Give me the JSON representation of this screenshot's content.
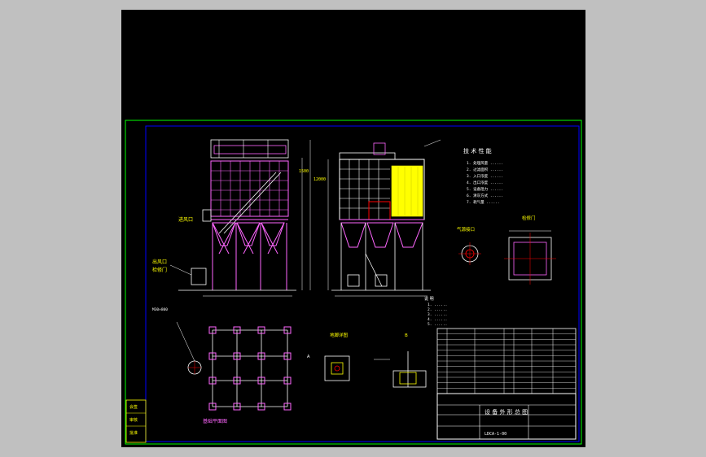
{
  "colors": {
    "background": "#c0c0c0",
    "canvas": "#000000",
    "border": "#00ff00",
    "structure": "#ff66ff",
    "line": "#ffffff",
    "dimension": "#ffff00",
    "accent": "#ff0000",
    "cyan": "#00ffff"
  },
  "drawing": {
    "tech_title": "技 术 性 能",
    "tech_lines": [
      "1. 处理风量 ......",
      "2. 过滤面积 ......",
      "3. 入口浓度 ......",
      "4. 出口浓度 ......",
      "5. 设备阻力 ......",
      "6. 清灰方式 ......",
      "7. 耗气量 ......"
    ],
    "inlet_label": "气源接口",
    "outlet_label": "检修门",
    "notes_title": "说 明",
    "notes_lines": [
      "1. ......",
      "2. ......",
      "3. ......",
      "4. ......",
      "5. ......"
    ],
    "detail_a_label": "地脚详图",
    "detail_b_label": "A",
    "detail_c_label": "B",
    "foundation_label": "基础平面图",
    "left_label_1": "进风口",
    "left_label_2": "出风口",
    "left_label_3": "检修门",
    "title_block": {
      "drawing_name": "设 备 外 形 总 图",
      "company": "",
      "drawing_number": "LDCA-1-00"
    },
    "side_stamp": [
      "会签",
      "审核",
      "批准"
    ]
  }
}
